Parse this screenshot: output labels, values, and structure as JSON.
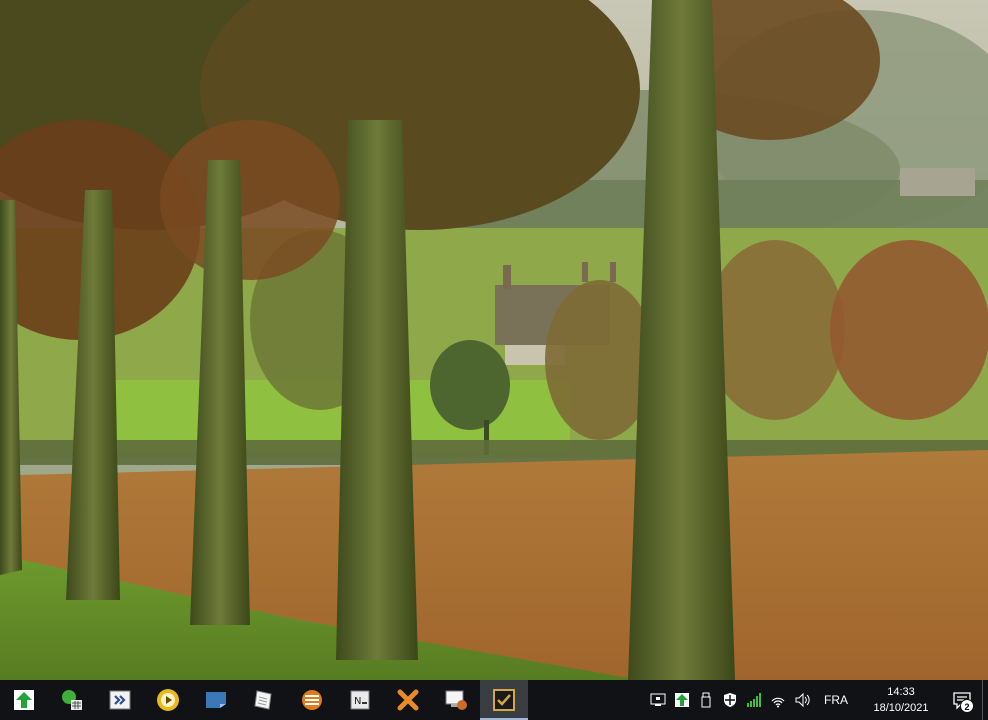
{
  "taskbar": {
    "apps": [
      {
        "name": "green-up-arrow-app",
        "icon": "green-arrow-icon"
      },
      {
        "name": "network-monitor-app",
        "icon": "green-globe-grid-icon"
      },
      {
        "name": "remote-desktop-app",
        "icon": "chevron-window-icon"
      },
      {
        "name": "media-player-app",
        "icon": "yellow-play-icon"
      },
      {
        "name": "sticky-notes-app",
        "icon": "blue-note-icon"
      },
      {
        "name": "document-editor-app",
        "icon": "white-paper-icon"
      },
      {
        "name": "list-app",
        "icon": "orange-list-icon"
      },
      {
        "name": "notepad-app",
        "icon": "notepad-icon"
      },
      {
        "name": "tools-app",
        "icon": "orange-cross-icon"
      },
      {
        "name": "screen-recorder-app",
        "icon": "monitor-record-icon"
      },
      {
        "name": "tasks-app",
        "icon": "checkbox-icon",
        "active": true
      }
    ],
    "tray": {
      "icons": [
        "display-icon",
        "green-arrow-icon",
        "usb-drive-icon",
        "shield-icon",
        "signal-bars-icon",
        "wifi-icon",
        "volume-icon"
      ],
      "language": "FRA",
      "time": "14:33",
      "date": "18/10/2021",
      "notification_count": "2"
    }
  }
}
